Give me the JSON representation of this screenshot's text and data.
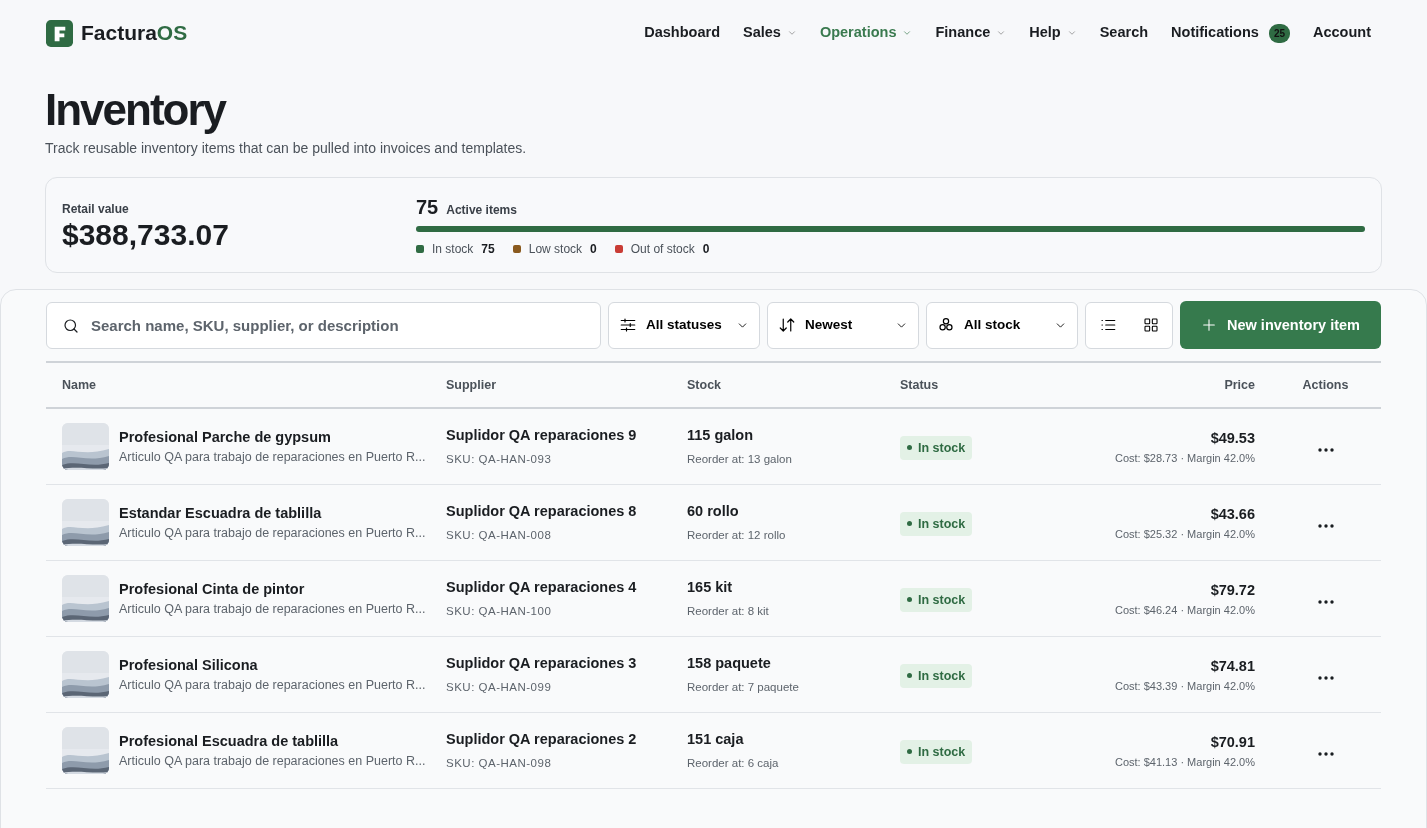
{
  "brand": {
    "name": "Factura",
    "accent": "OS"
  },
  "nav": [
    {
      "label": "Dashboard",
      "has_menu": false,
      "selected": false
    },
    {
      "label": "Sales",
      "has_menu": true,
      "selected": false
    },
    {
      "label": "Operations",
      "has_menu": true,
      "selected": true
    },
    {
      "label": "Finance",
      "has_menu": true,
      "selected": false
    },
    {
      "label": "Help",
      "has_menu": true,
      "selected": false
    },
    {
      "label": "Search",
      "has_menu": false,
      "selected": false
    },
    {
      "label": "Notifications",
      "has_menu": false,
      "selected": false,
      "badge": "25"
    },
    {
      "label": "Account",
      "has_menu": false,
      "selected": false
    }
  ],
  "page": {
    "title": "Inventory",
    "subtitle": "Track reusable inventory items that can be pulled into invoices and templates."
  },
  "summary": {
    "retail_label": "Retail value",
    "retail_value": "$388,733.07",
    "active_count": "75",
    "active_label": "Active items",
    "bar": {
      "level": 1.0
    },
    "legend": [
      {
        "label": "In stock",
        "count": "75",
        "color": "#2f6b43"
      },
      {
        "label": "Low stock",
        "count": "0",
        "color": "#8a5a1e"
      },
      {
        "label": "Out of stock",
        "count": "0",
        "color": "#c93c35"
      }
    ]
  },
  "toolbar": {
    "search": {
      "placeholder": "Search name, SKU, supplier, or description"
    },
    "filters": [
      {
        "kind": "status",
        "value": "All statuses"
      },
      {
        "kind": "sort",
        "value": "Newest"
      },
      {
        "kind": "stock",
        "value": "All stock"
      }
    ],
    "new_button": "New inventory item"
  },
  "table": {
    "columns": [
      "Name",
      "Supplier",
      "Stock",
      "Status",
      "Price",
      "Actions"
    ],
    "rows": [
      {
        "name": "Profesional Parche de gypsum",
        "description": "Articulo QA para trabajo de reparaciones en Puerto R...",
        "supplier": "Suplidor QA reparaciones 9",
        "sku": "SKU: QA-HAN-093",
        "stock": "115 galon",
        "reorder": "Reorder at: 13 galon",
        "status": "In stock",
        "price": "$49.53",
        "cost": "Cost: $28.73 · Margin 42.0%"
      },
      {
        "name": "Estandar Escuadra de tablilla",
        "description": "Articulo QA para trabajo de reparaciones en Puerto R...",
        "supplier": "Suplidor QA reparaciones 8",
        "sku": "SKU: QA-HAN-008",
        "stock": "60 rollo",
        "reorder": "Reorder at: 12 rollo",
        "status": "In stock",
        "price": "$43.66",
        "cost": "Cost: $25.32 · Margin 42.0%"
      },
      {
        "name": "Profesional Cinta de pintor",
        "description": "Articulo QA para trabajo de reparaciones en Puerto R...",
        "supplier": "Suplidor QA reparaciones 4",
        "sku": "SKU: QA-HAN-100",
        "stock": "165 kit",
        "reorder": "Reorder at: 8 kit",
        "status": "In stock",
        "price": "$79.72",
        "cost": "Cost: $46.24 · Margin 42.0%"
      },
      {
        "name": "Profesional Silicona",
        "description": "Articulo QA para trabajo de reparaciones en Puerto R...",
        "supplier": "Suplidor QA reparaciones 3",
        "sku": "SKU: QA-HAN-099",
        "stock": "158 paquete",
        "reorder": "Reorder at: 7 paquete",
        "status": "In stock",
        "price": "$74.81",
        "cost": "Cost: $43.39 · Margin 42.0%"
      },
      {
        "name": "Profesional Escuadra de tablilla",
        "description": "Articulo QA para trabajo de reparaciones en Puerto R...",
        "supplier": "Suplidor QA reparaciones 2",
        "sku": "SKU: QA-HAN-098",
        "stock": "151 caja",
        "reorder": "Reorder at: 6 caja",
        "status": "In stock",
        "price": "$70.91",
        "cost": "Cost: $41.13 · Margin 42.0%"
      }
    ]
  }
}
